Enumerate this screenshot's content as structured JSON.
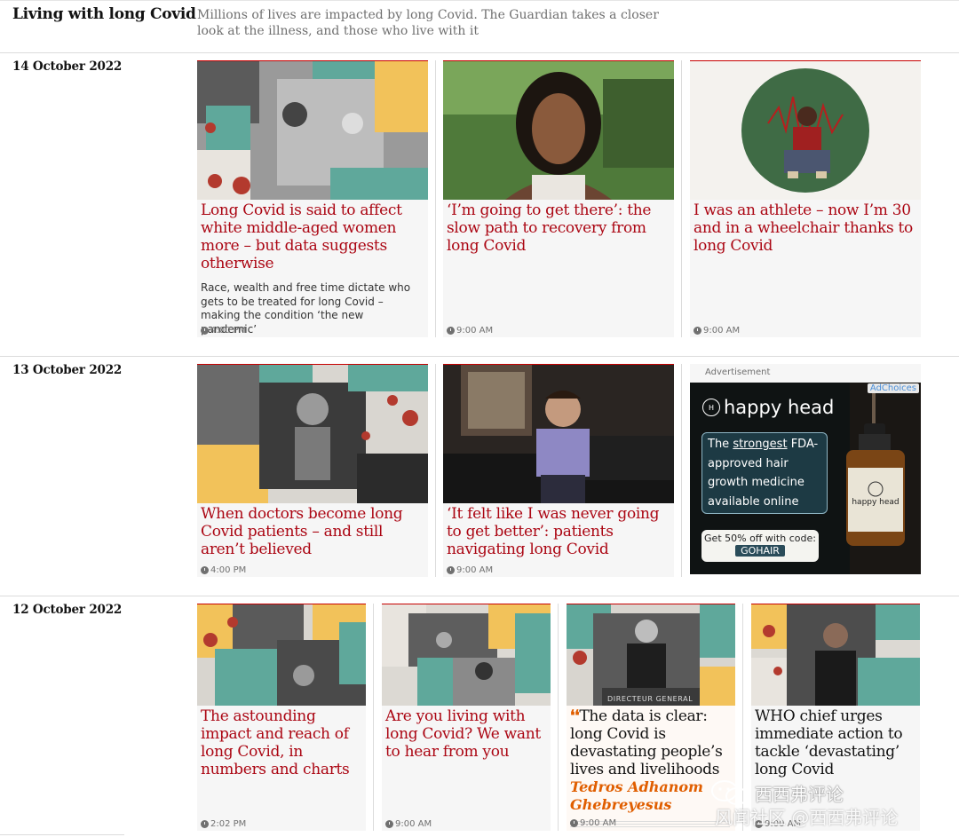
{
  "header": {
    "title": "Living with long Covid",
    "description": "Millions of lives are impacted by long Covid. The Guardian takes a closer look at the illness, and those who live with it"
  },
  "sections": [
    {
      "date": "14 October 2022",
      "cards": [
        {
          "headline": "Long Covid is said to affect white middle-aged women more – but data suggests otherwise",
          "standfirst": "Race, wealth and free time dictate who gets to be treated for long Covid – making the condition ‘the new pandemic’",
          "time": "4:00 PM"
        },
        {
          "headline": "‘I’m going to get there’: the slow path to recovery from long Covid",
          "time": "9:00 AM"
        },
        {
          "headline": "I was an athlete – now I’m 30 and in a wheelchair thanks to long Covid",
          "time": "9:00 AM"
        }
      ]
    },
    {
      "date": "13 October 2022",
      "cards": [
        {
          "headline": "When doctors become long Covid patients – and still aren’t believed",
          "time": "4:00 PM"
        },
        {
          "headline": "‘It felt like I was never going to get better’: patients navigating long Covid",
          "time": "9:00 AM"
        }
      ],
      "ad": {
        "label": "Advertisement",
        "adchoices": "AdChoices",
        "brand": "happy head",
        "brand_mark": "H",
        "line_before": "The ",
        "line_emph": "strongest",
        "line_after": " FDA-approved hair growth medicine available online",
        "offer": "Get 50% off with code:",
        "code": "GOHAIR",
        "bottle_label": "happy head"
      }
    },
    {
      "date": "12 October 2022",
      "cards": [
        {
          "headline": "The astounding impact and reach of long Covid, in numbers and charts",
          "time": "2:02 PM"
        },
        {
          "headline": "Are you living with long Covid? We want to hear from you",
          "time": "9:00 AM"
        },
        {
          "quote_mark": "❛❛",
          "headline": "The data is clear: long Covid is devastating people’s lives and livelihoods",
          "byline": "Tedros Adhanom Ghebreyesus",
          "image_caption": "DIRECTEUR GENERAL",
          "time": "9:00 AM"
        },
        {
          "headline": "WHO chief urges immediate action to tackle ‘devastating’ long Covid",
          "time": "9:00 AM"
        }
      ]
    }
  ],
  "watermark": {
    "line1": "西西弗评论",
    "line2": "风闻社区 @西西弗评论"
  },
  "colors": {
    "headline_red": "#ab0613",
    "opinion_orange": "#e05e00",
    "card_bg": "#f6f6f6",
    "collage_teal": "#5fa89b",
    "collage_yellow": "#f2c25a"
  }
}
